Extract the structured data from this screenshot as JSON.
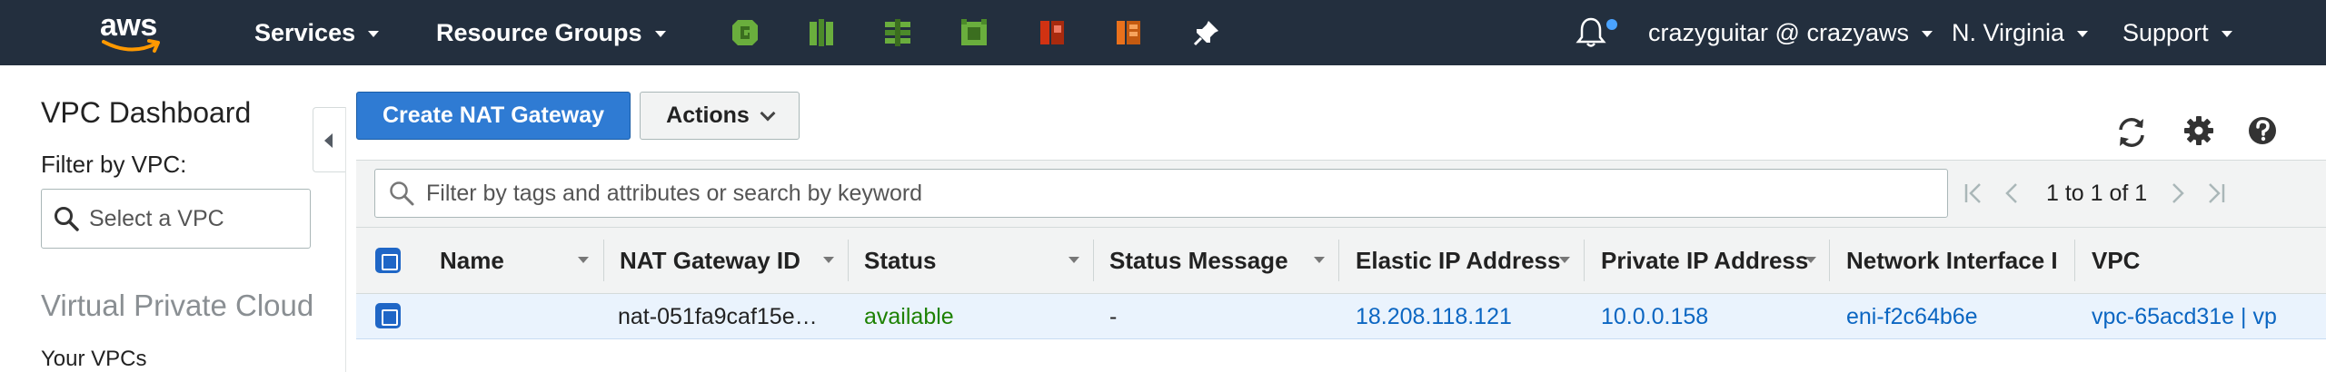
{
  "topnav": {
    "logo_text": "aws",
    "services_label": "Services",
    "resource_groups_label": "Resource Groups",
    "pinned_services": [
      {
        "icon": "service-green-icon-1",
        "color": "#6aae3d"
      },
      {
        "icon": "service-green-icon-2",
        "color": "#6aae3d"
      },
      {
        "icon": "service-green-icon-3",
        "color": "#6aae3d"
      },
      {
        "icon": "service-green-icon-4",
        "color": "#6aae3d"
      },
      {
        "icon": "service-red-icon",
        "color": "#d13212"
      },
      {
        "icon": "service-orange-icon",
        "color": "#e9711c"
      },
      {
        "icon": "pin-icon",
        "color": "#ffffff"
      }
    ],
    "account_label": "crazyguitar @ crazyaws",
    "region_label": "N. Virginia",
    "support_label": "Support"
  },
  "sidebar": {
    "title": "VPC Dashboard",
    "filter_label": "Filter by VPC:",
    "select_placeholder": "Select a VPC",
    "section_title": "Virtual Private Cloud",
    "first_link": "Your VPCs"
  },
  "toolbar": {
    "create_label": "Create NAT Gateway",
    "actions_label": "Actions"
  },
  "filter": {
    "placeholder": "Filter by tags and attributes or search by keyword",
    "pagination": "1 to 1 of 1"
  },
  "table": {
    "columns": [
      "Name",
      "NAT Gateway ID",
      "Status",
      "Status Message",
      "Elastic IP Address",
      "Private IP Address",
      "Network Interface I",
      "VPC"
    ],
    "rows": [
      {
        "name": "",
        "nat_gateway_id": "nat-051fa9caf15e…",
        "status": "available",
        "status_message": "-",
        "elastic_ip": "18.208.118.121",
        "private_ip": "10.0.0.158",
        "network_interface": "eni-f2c64b6e",
        "vpc": "vpc-65acd31e | vp"
      }
    ]
  },
  "colors": {
    "nav_bg": "#232f3e",
    "primary_button": "#2f7bd3",
    "link": "#0b66c2",
    "status_ok": "#1d8102",
    "selected_row": "#eaf3fd"
  }
}
